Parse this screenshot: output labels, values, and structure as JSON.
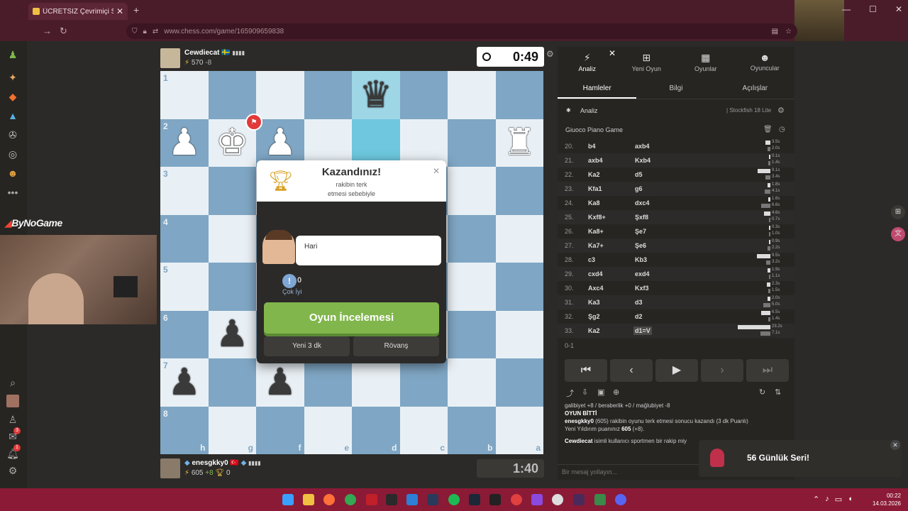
{
  "browser": {
    "tab_title": "ÜCRETSİZ Çevrimiçi Satranç",
    "url": "www.chess.com/game/165909659838"
  },
  "sidebar": {
    "items": [
      "pawn-icon",
      "puzzle-icon",
      "play-icon",
      "learn-icon",
      "watch-icon",
      "social-icon",
      "friends-icon",
      "more-icon"
    ],
    "bottom": [
      "search-icon",
      "avatar",
      "friends-icon",
      "messages-icon",
      "notifications-icon",
      "settings-icon"
    ],
    "messages_badge": "3",
    "notifications_badge": "1"
  },
  "stream": {
    "brand": "ByNoGame"
  },
  "top_player": {
    "name": "Cewdiecat",
    "flag": "🇸🇪",
    "rating": "570",
    "diff": "-8",
    "clock": "0:49"
  },
  "bottom_player": {
    "name": "enesgkky0",
    "flag": "🇹🇷",
    "rating": "605",
    "diff": "+8",
    "trophies": "0",
    "clock": "1:40"
  },
  "board": {
    "ranks": [
      "1",
      "2",
      "3",
      "4",
      "5",
      "6",
      "7",
      "8"
    ],
    "files": [
      "h",
      "g",
      "f",
      "e",
      "d",
      "c",
      "b",
      "a"
    ]
  },
  "modal": {
    "title": "Kazandınız!",
    "subtitle_1": "rakibin terk",
    "subtitle_2": "etmesi sebebiyle",
    "coach_message": "Hari",
    "stat_value": "0",
    "stat_label": "Çok İyi",
    "review_button": "Oyun İncelemesi",
    "new_game_button": "Yeni 3 dk",
    "rematch_button": "Rövanş"
  },
  "panel": {
    "tabs": [
      "Analiz",
      "Yeni Oyun",
      "Oyunlar",
      "Oyuncular"
    ],
    "subtabs": [
      "Hamleler",
      "Bilgi",
      "Açılışlar"
    ],
    "analysis_label": "Analiz",
    "engine": "Stockfish 18 Lite",
    "opening": "Giuoco Piano Game",
    "moves": [
      {
        "n": "20.",
        "w": "b4",
        "b": "axb4",
        "tw": "3.5s",
        "tb": "2.0s",
        "fw": 0.15,
        "fb": 0.09
      },
      {
        "n": "21.",
        "w": "axb4",
        "b": "Kxb4",
        "tw": "0.1s",
        "tb": "1.4s",
        "fw": 0.01,
        "fb": 0.06
      },
      {
        "n": "22.",
        "w": "Ka2",
        "b": "d5",
        "tw": "9.1s",
        "tb": "3.4s",
        "fw": 0.39,
        "fb": 0.15
      },
      {
        "n": "23.",
        "w": "Kfa1",
        "b": "g6",
        "tw": "1.8s",
        "tb": "4.1s",
        "fw": 0.08,
        "fb": 0.18
      },
      {
        "n": "24.",
        "w": "Ka8",
        "b": "dxc4",
        "tw": "1.6s",
        "tb": "6.6s",
        "fw": 0.07,
        "fb": 0.28
      },
      {
        "n": "25.",
        "w": "Kxf8+",
        "b": "Şxf8",
        "tw": "4.6s",
        "tb": "0.7s",
        "fw": 0.2,
        "fb": 0.03
      },
      {
        "n": "26.",
        "w": "Ka8+",
        "b": "Şe7",
        "tw": "0.3s",
        "tb": "1.0s",
        "fw": 0.01,
        "fb": 0.04
      },
      {
        "n": "27.",
        "w": "Ka7+",
        "b": "Şe6",
        "tw": "0.9s",
        "tb": "2.2s",
        "fw": 0.04,
        "fb": 0.09
      },
      {
        "n": "28.",
        "w": "c3",
        "b": "Kb3",
        "tw": "9.5s",
        "tb": "3.2s",
        "fw": 0.41,
        "fb": 0.14
      },
      {
        "n": "29.",
        "w": "cxd4",
        "b": "exd4",
        "tw": "1.9s",
        "tb": "1.1s",
        "fw": 0.08,
        "fb": 0.05
      },
      {
        "n": "30.",
        "w": "Axc4",
        "b": "Kxf3",
        "tw": "2.3s",
        "tb": "1.5s",
        "fw": 0.1,
        "fb": 0.06
      },
      {
        "n": "31.",
        "w": "Ka3",
        "b": "d3",
        "tw": "2.0s",
        "tb": "5.0s",
        "fw": 0.09,
        "fb": 0.21
      },
      {
        "n": "32.",
        "w": "Şg2",
        "b": "d2",
        "tw": "6.5s",
        "tb": "1.4s",
        "fw": 0.28,
        "fb": 0.06
      },
      {
        "n": "33.",
        "w": "Ka2",
        "b": "d1=V",
        "tw": "23.2s",
        "tb": "7.1s",
        "fw": 1.0,
        "fb": 0.3
      }
    ],
    "result": "0-1",
    "chat": {
      "line0": "galibiyet +8 / beraberlik +0 / mağlubiyet -8",
      "heading": "OYUN BİTTİ",
      "winner": "enesgkky0",
      "line1": " (605) rakibin oyunu terk etmesi sonucu kazandı (3 dk Puanlı)",
      "line2a": "Yeni Yıldırım puanınız ",
      "line2b": "605",
      "line2c": " (+8).",
      "opponent": "Cewdiecat",
      "line3": " isimli kullanıcı sportmen bir rakip miy"
    },
    "chat_placeholder": "Bir mesaj yollayın..."
  },
  "toast": {
    "text": "56  Günlük Seri!"
  },
  "taskbar": {
    "time": "00:22",
    "date": "14.03.2026"
  },
  "colors": {
    "light_square": "#e9f0f5",
    "dark_square": "#7fa6c4",
    "highlight": "#9fd6e6",
    "green": "#81b64c",
    "chrome": "#4a1c2a",
    "taskbar": "#8b1a36"
  }
}
